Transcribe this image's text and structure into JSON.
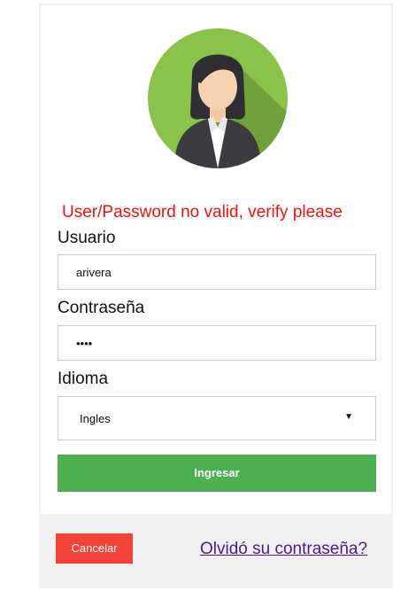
{
  "error_message": "User/Password no valid, verify please",
  "form": {
    "username_label": "Usuario",
    "username_value": "arivera",
    "password_label": "Contraseña",
    "password_value": "••••",
    "language_label": "Idioma",
    "language_value": "Ingles",
    "language_arrow": "▼",
    "submit_label": "Ingresar"
  },
  "footer": {
    "cancel_label": "Cancelar",
    "forgot_label": "Olvidó su contraseña?"
  },
  "colors": {
    "error": "#ee1111",
    "submit": "#4caf50",
    "cancel": "#f44336",
    "link": "#4b1a8c",
    "avatar_bg": "#8bc34a"
  },
  "icons": {
    "avatar": "user-avatar-icon",
    "dropdown": "chevron-down-icon"
  }
}
